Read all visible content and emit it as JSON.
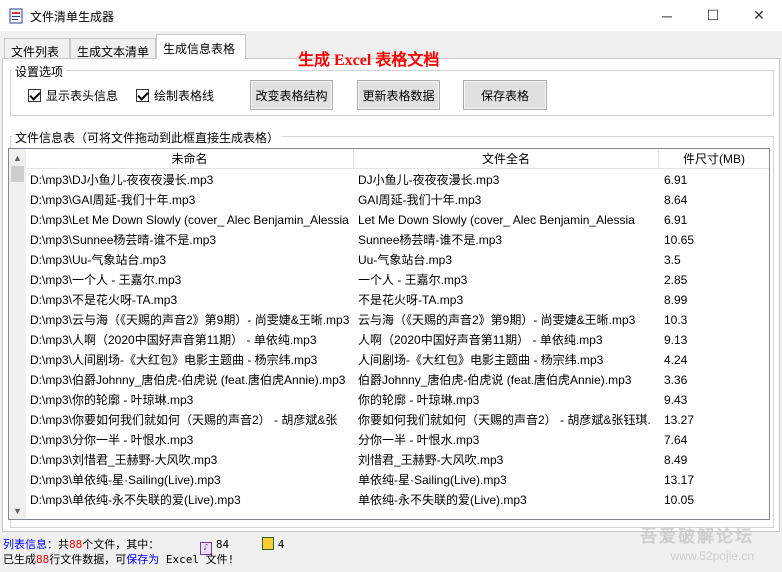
{
  "window": {
    "title": "文件清单生成器",
    "controls": {
      "minimize": "─",
      "maximize": "☐",
      "close": "✕"
    }
  },
  "tabs": [
    "文件列表",
    "生成文本清单",
    "生成信息表格"
  ],
  "headline": "生成 Excel 表格文档",
  "settings": {
    "legend": "设置选项",
    "checkbox_header": "显示表头信息",
    "checkbox_gridlines": "绘制表格线",
    "btn_change": "改变表格结构",
    "btn_update": "更新表格数据",
    "btn_save": "保存表格"
  },
  "list": {
    "legend": "文件信息表（可将文件拖动到此框直接生成表格）",
    "columns": [
      "未命名",
      "文件全名",
      "件尺寸(MB)"
    ],
    "rows": [
      [
        "D:\\mp3\\DJ小鱼儿-夜夜夜漫长.mp3",
        "DJ小鱼儿-夜夜夜漫长.mp3",
        "6.91"
      ],
      [
        "D:\\mp3\\GAI周延-我们十年.mp3",
        "GAI周延-我们十年.mp3",
        "8.64"
      ],
      [
        "D:\\mp3\\Let Me Down Slowly (cover_ Alec Benjamin_Alessia",
        "Let Me Down Slowly (cover_ Alec Benjamin_Alessia",
        "6.91"
      ],
      [
        "D:\\mp3\\Sunnee杨芸晴-谁不是.mp3",
        "Sunnee杨芸晴-谁不是.mp3",
        "10.65"
      ],
      [
        "D:\\mp3\\Uu-气象站台.mp3",
        "Uu-气象站台.mp3",
        "3.5"
      ],
      [
        "D:\\mp3\\一个人 - 王嘉尔.mp3",
        "一个人 - 王嘉尔.mp3",
        "2.85"
      ],
      [
        "D:\\mp3\\不是花火呀-TA.mp3",
        "不是花火呀-TA.mp3",
        "8.99"
      ],
      [
        "D:\\mp3\\云与海（《天赐的声音2》第9期）- 尚雯婕&王晰.mp3",
        "云与海（《天赐的声音2》第9期）- 尚雯婕&王晰.mp3",
        "10.3"
      ],
      [
        "D:\\mp3\\人啊（2020中国好声音第11期） - 单依纯.mp3",
        "人啊（2020中国好声音第11期） - 单依纯.mp3",
        "9.13"
      ],
      [
        "D:\\mp3\\人间剧场-《大红包》电影主题曲 - 杨宗纬.mp3",
        "人间剧场-《大红包》电影主题曲 - 杨宗纬.mp3",
        "4.24"
      ],
      [
        "D:\\mp3\\伯爵Johnny_唐伯虎-伯虎说 (feat.唐伯虎Annie).mp3",
        "伯爵Johnny_唐伯虎-伯虎说 (feat.唐伯虎Annie).mp3",
        "3.36"
      ],
      [
        "D:\\mp3\\你的轮廓 - 叶琼琳.mp3",
        "你的轮廓 - 叶琼琳.mp3",
        "9.43"
      ],
      [
        "D:\\mp3\\你要如何我们就如何（天赐的声音2） - 胡彦斌&张",
        "你要如何我们就如何（天赐的声音2） - 胡彦斌&张钰琪.",
        "13.27"
      ],
      [
        "D:\\mp3\\分你一半 - 叶恨水.mp3",
        "分你一半 - 叶恨水.mp3",
        "7.64"
      ],
      [
        "D:\\mp3\\刘惜君_王赫野-大风吹.mp3",
        "刘惜君_王赫野-大风吹.mp3",
        "8.49"
      ],
      [
        "D:\\mp3\\单依纯-星·Sailing(Live).mp3",
        "单依纯-星·Sailing(Live).mp3",
        "13.17"
      ],
      [
        "D:\\mp3\\单依纯-永不失联的爱(Live).mp3",
        "单依纯-永不失联的爱(Live).mp3",
        "10.05"
      ]
    ]
  },
  "status": {
    "line1_prefix": "列表信息：",
    "line1_mid1": "共",
    "line1_total": "88",
    "line1_mid2": "个文件，其中：",
    "count_music": "84",
    "count_other": "4",
    "line2_prefix": "已生成",
    "line2_count": "88",
    "line2_mid": "行文件数据，可",
    "line2_link": "保存为",
    "line2_suffix": " Excel 文件!"
  },
  "watermark": {
    "line1": "吾爱破解论坛",
    "line2": "www.52pojie.cn"
  },
  "colors": {
    "headline": "#ff0000",
    "status_blue": "#0000ff",
    "status_red": "#ff0000"
  }
}
